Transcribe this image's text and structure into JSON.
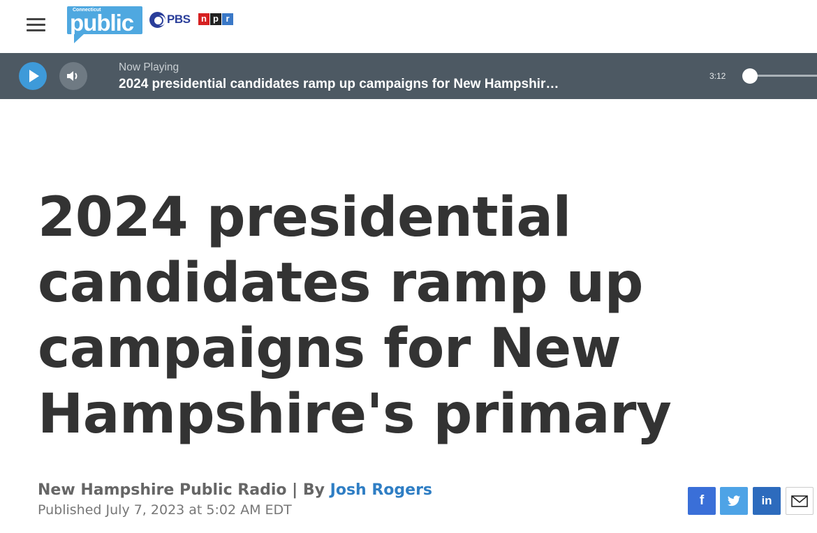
{
  "header": {
    "logo_small_text": "Connecticut",
    "logo_word": "public",
    "pbs_text": "PBS",
    "npr_letters": [
      "n",
      "p",
      "r"
    ]
  },
  "player": {
    "now_playing_label": "Now Playing",
    "title": "2024 presidential candidates ramp up campaigns for New Hampshir…",
    "time": "3:12",
    "progress": 0.0
  },
  "article": {
    "headline": "2024 presidential candidates ramp up campaigns for New Hampshire's primary",
    "source": "New Hampshire Public Radio",
    "by_label": "| By",
    "author": "Josh Rogers",
    "published": "Published July 7, 2023 at 5:02 AM EDT"
  },
  "share": {
    "facebook_glyph": "f",
    "linkedin_glyph": "in"
  },
  "colors": {
    "player_bg": "#4d5963",
    "play_button": "#3e9ad9",
    "facebook": "#3a6fd8",
    "twitter": "#4ea3e6",
    "linkedin": "#2d6bbd",
    "author_link": "#2f7ec4"
  },
  "icons": [
    "hamburger-menu-icon",
    "play-icon",
    "volume-icon",
    "facebook-icon",
    "twitter-icon",
    "linkedin-icon",
    "email-icon"
  ]
}
